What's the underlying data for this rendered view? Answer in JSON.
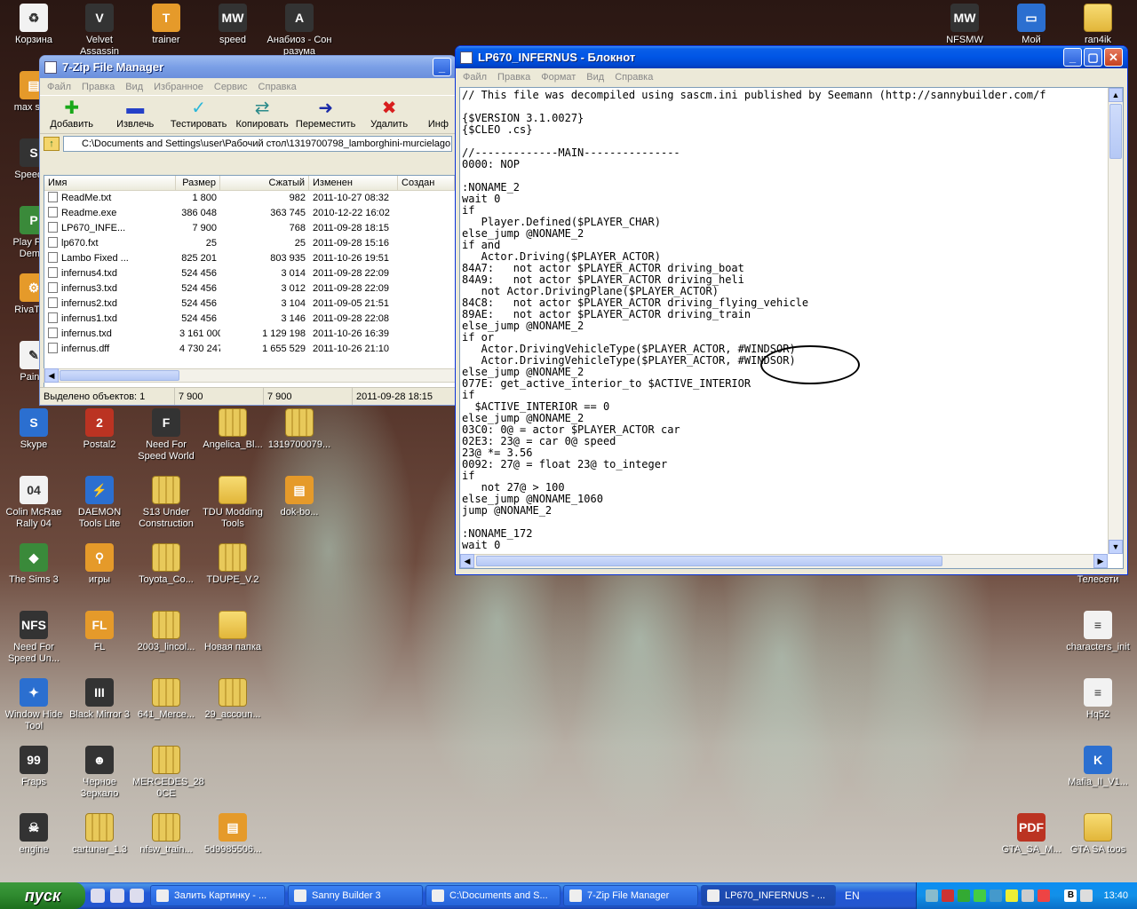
{
  "desktop": {
    "icons": [
      {
        "label": "Корзина",
        "glyph": "♻",
        "style": "white"
      },
      {
        "label": "Velvet Assassin",
        "glyph": "V",
        "style": "dark"
      },
      {
        "label": "trainer",
        "glyph": "T",
        "style": "orange"
      },
      {
        "label": "speed",
        "glyph": "MW",
        "style": "dark"
      },
      {
        "label": "Анабиоз - Сон разума",
        "glyph": "A",
        "style": "dark"
      },
      {
        "label": "NFSMW Dodge",
        "glyph": "MW",
        "style": "dark"
      },
      {
        "label": "Мой",
        "glyph": "▭",
        "style": "blue"
      },
      {
        "label": "ran4ik",
        "glyph": "",
        "style": "folder"
      },
      {
        "label": "max sp...",
        "glyph": "▤",
        "style": "orange"
      },
      {
        "label": "Speedl...",
        "glyph": "S",
        "style": "dark"
      },
      {
        "label": "Play Pu... Dem...",
        "glyph": "P",
        "style": "green"
      },
      {
        "label": "RivaTu...",
        "glyph": "⚙",
        "style": "orange"
      },
      {
        "label": "Pain...",
        "glyph": "✎",
        "style": "white"
      },
      {
        "label": "Skype",
        "glyph": "S",
        "style": "blue"
      },
      {
        "label": "Postal2",
        "glyph": "2",
        "style": "red"
      },
      {
        "label": "Need For Speed World",
        "glyph": "F",
        "style": "dark"
      },
      {
        "label": "Angelica_Bl...",
        "glyph": "",
        "style": "zip"
      },
      {
        "label": "1319700079...",
        "glyph": "",
        "style": "zip"
      },
      {
        "label": "Colin McRae Rally 04",
        "glyph": "04",
        "style": "white"
      },
      {
        "label": "DAEMON Tools Lite",
        "glyph": "⚡",
        "style": "blue"
      },
      {
        "label": "S13 Under Construction",
        "glyph": "",
        "style": "zip"
      },
      {
        "label": "TDU Modding Tools",
        "glyph": "",
        "style": "folder"
      },
      {
        "label": "dok-bo...",
        "glyph": "▤",
        "style": "orange"
      },
      {
        "label": "The Sims 3",
        "glyph": "◆",
        "style": "green"
      },
      {
        "label": "игры",
        "glyph": "⚲",
        "style": "orange"
      },
      {
        "label": "Toyota_Co...",
        "glyph": "",
        "style": "zip"
      },
      {
        "label": "TDUPE_V.2",
        "glyph": "",
        "style": "zip"
      },
      {
        "label": "Телесети",
        "glyph": "",
        "style": "none"
      },
      {
        "label": "Need For Speed Un...",
        "glyph": "NFS",
        "style": "dark"
      },
      {
        "label": "FL",
        "glyph": "FL",
        "style": "orange"
      },
      {
        "label": "2003_lincol...",
        "glyph": "",
        "style": "zip"
      },
      {
        "label": "Новая папка",
        "glyph": "",
        "style": "folder"
      },
      {
        "label": "characters_init",
        "glyph": "≡",
        "style": "white"
      },
      {
        "label": "Window Hide Tool",
        "glyph": "✦",
        "style": "blue"
      },
      {
        "label": "Black Mirror 3",
        "glyph": "III",
        "style": "dark"
      },
      {
        "label": "641_Merce...",
        "glyph": "",
        "style": "zip"
      },
      {
        "label": "29_accoun...",
        "glyph": "",
        "style": "zip"
      },
      {
        "label": "Hq52",
        "glyph": "≡",
        "style": "white"
      },
      {
        "label": "Fraps",
        "glyph": "99",
        "style": "dark"
      },
      {
        "label": "Черное Зеркало",
        "glyph": "☻",
        "style": "dark"
      },
      {
        "label": "MERCEDES_28 0CE",
        "glyph": "",
        "style": "zip"
      },
      {
        "label": "Mafia_II_V1...",
        "glyph": "K",
        "style": "blue"
      },
      {
        "label": "engine",
        "glyph": "☠",
        "style": "dark"
      },
      {
        "label": "cartuner_1.3",
        "glyph": "",
        "style": "zip"
      },
      {
        "label": "nfsw_train...",
        "glyph": "",
        "style": "zip"
      },
      {
        "label": "5d9985506...",
        "glyph": "▤",
        "style": "orange"
      },
      {
        "label": "GTA_SA_M...",
        "glyph": "PDF",
        "style": "red"
      },
      {
        "label": "GTA SA toos",
        "glyph": "",
        "style": "folder"
      }
    ]
  },
  "zip": {
    "title": "7-Zip File Manager",
    "menu": [
      "Файл",
      "Правка",
      "Вид",
      "Избранное",
      "Сервис",
      "Справка"
    ],
    "toolbar": [
      {
        "label": "Добавить",
        "glyph": "✚",
        "color": "#19a819"
      },
      {
        "label": "Извлечь",
        "glyph": "▬",
        "color": "#2440c8"
      },
      {
        "label": "Тестировать",
        "glyph": "✓",
        "color": "#2bb7d9"
      },
      {
        "label": "Копировать",
        "glyph": "⇄",
        "color": "#2a8a8a"
      },
      {
        "label": "Переместить",
        "glyph": "➜",
        "color": "#1b2ba8"
      },
      {
        "label": "Удалить",
        "glyph": "✖",
        "color": "#d81e1e"
      },
      {
        "label": "Инф",
        "glyph": "",
        "color": "#000"
      }
    ],
    "path": "C:\\Documents and Settings\\user\\Рабочий стол\\1319700798_lamborghini-murcielago",
    "columns": [
      "Имя",
      "Размер",
      "Сжатый",
      "Изменен",
      "Создан"
    ],
    "rows": [
      {
        "name": "ReadMe.txt",
        "size": "1 800",
        "packed": "982",
        "modified": "2011-10-27 08:32"
      },
      {
        "name": "Readme.exe",
        "size": "386 048",
        "packed": "363 745",
        "modified": "2010-12-22 16:02"
      },
      {
        "name": "LP670_INFE...",
        "size": "7 900",
        "packed": "768",
        "modified": "2011-09-28 18:15"
      },
      {
        "name": "lp670.fxt",
        "size": "25",
        "packed": "25",
        "modified": "2011-09-28 15:16"
      },
      {
        "name": "Lambo Fixed ...",
        "size": "825 201",
        "packed": "803 935",
        "modified": "2011-10-26 19:51"
      },
      {
        "name": "infernus4.txd",
        "size": "524 456",
        "packed": "3 014",
        "modified": "2011-09-28 22:09"
      },
      {
        "name": "infernus3.txd",
        "size": "524 456",
        "packed": "3 012",
        "modified": "2011-09-28 22:09"
      },
      {
        "name": "infernus2.txd",
        "size": "524 456",
        "packed": "3 104",
        "modified": "2011-09-05 21:51"
      },
      {
        "name": "infernus1.txd",
        "size": "524 456",
        "packed": "3 146",
        "modified": "2011-09-28 22:08"
      },
      {
        "name": "infernus.txd",
        "size": "3 161 000",
        "packed": "1 129 198",
        "modified": "2011-10-26 16:39"
      },
      {
        "name": "infernus.dff",
        "size": "4 730 247",
        "packed": "1 655 529",
        "modified": "2011-10-26 21:10"
      }
    ],
    "status": {
      "selected": "Выделено объектов: 1",
      "size": "7 900",
      "packed": "7 900",
      "date": "2011-09-28 18:15"
    }
  },
  "notepad": {
    "title": "LP670_INFERNUS - Блокнот",
    "menu": [
      "Файл",
      "Правка",
      "Формат",
      "Вид",
      "Справка"
    ],
    "lines": [
      "// This file was decompiled using sascm.ini published by Seemann (http://sannybuilder.com/f",
      "",
      "{$VERSION 3.1.0027}",
      "{$CLEO .cs}",
      "",
      "//-------------MAIN---------------",
      "0000: NOP",
      "",
      ":NONAME_2",
      "wait 0",
      "if",
      "   Player.Defined($PLAYER_CHAR)",
      "else_jump @NONAME_2",
      "if and",
      "   Actor.Driving($PLAYER_ACTOR)",
      "84A7:   not actor $PLAYER_ACTOR driving_boat",
      "84A9:   not actor $PLAYER_ACTOR driving_heli",
      "   not Actor.DrivingPlane($PLAYER_ACTOR)",
      "84C8:   not actor $PLAYER_ACTOR driving_flying_vehicle",
      "89AE:   not actor $PLAYER_ACTOR driving_train",
      "else_jump @NONAME_2",
      "if or",
      "   Actor.DrivingVehicleType($PLAYER_ACTOR, #WINDSOR)",
      "   Actor.DrivingVehicleType($PLAYER_ACTOR, #WINDSOR)",
      "else_jump @NONAME_2",
      "077E: get_active_interior_to $ACTIVE_INTERIOR",
      "if",
      "  $ACTIVE_INTERIOR == 0",
      "else_jump @NONAME_2",
      "03C0: 0@ = actor $PLAYER_ACTOR car",
      "02E3: 23@ = car 0@ speed",
      "23@ *= 3.56",
      "0092: 27@ = float 23@ to_integer",
      "if",
      "   not 27@ > 100",
      "else_jump @NONAME_1060",
      "jump @NONAME_2",
      "",
      ":NONAME_172",
      "wait 0"
    ]
  },
  "taskbar": {
    "start": "пуск",
    "items": [
      "Залить Картинку - ...",
      "Sanny Builder 3",
      "C:\\Documents and S...",
      "7-Zip File Manager",
      "LP670_INFERNUS - ..."
    ],
    "lang": "EN",
    "clock": "13:40"
  }
}
